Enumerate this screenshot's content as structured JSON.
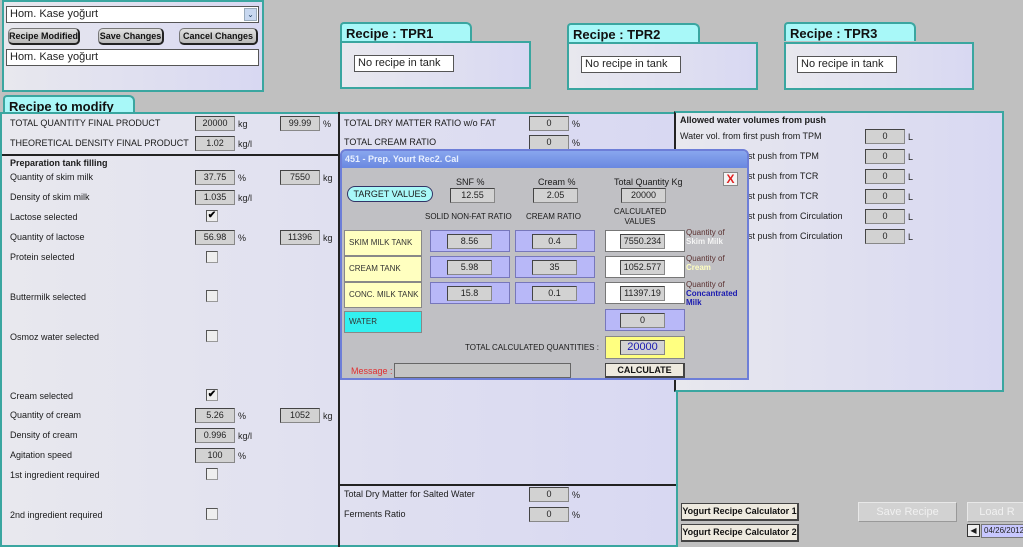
{
  "top_panel": {
    "recipe_select": "Hom. Kase yoğurt",
    "recipe_modified_label": "Recipe Modified",
    "save_changes_label": "Save Changes",
    "cancel_changes_label": "Cancel Changes",
    "recipe_name": "Hom. Kase yoğurt"
  },
  "tanks": [
    {
      "title": "Recipe : TPR1",
      "status": "No recipe in tank"
    },
    {
      "title": "Recipe : TPR2",
      "status": "No recipe in tank"
    },
    {
      "title": "Recipe : TPR3",
      "status": "No recipe in tank"
    }
  ],
  "recipe": {
    "tab_title": "Recipe to modify",
    "total_quantity": {
      "label": "TOTAL QUANTITY FINAL PRODUCT",
      "value": "20000",
      "unit": "kg",
      "value2": "99.99",
      "unit2": "%"
    },
    "theoretical_density": {
      "label": "THEORETICAL DENSITY FINAL PRODUCT",
      "value": "1.02",
      "unit": "kg/l"
    },
    "prep_heading": "Preparation tank filling",
    "skim_qty": {
      "label": "Quantity of skim milk",
      "value": "37.75",
      "unit": "%",
      "value2": "7550",
      "unit2": "kg"
    },
    "skim_density": {
      "label": "Density of skim milk",
      "value": "1.035",
      "unit": "kg/l"
    },
    "lactose_selected": {
      "label": "Lactose selected",
      "checked": "✔"
    },
    "lactose_qty": {
      "label": "Quantity of lactose",
      "value": "56.98",
      "unit": "%",
      "value2": "11396",
      "unit2": "kg"
    },
    "protein_selected": {
      "label": "Protein selected",
      "checked": ""
    },
    "buttermilk_selected": {
      "label": "Buttermilk selected",
      "checked": ""
    },
    "osmoz_selected": {
      "label": "Osmoz water selected",
      "checked": ""
    },
    "cream_selected": {
      "label": "Cream selected",
      "checked": "✔"
    },
    "cream_qty": {
      "label": "Quantity of cream",
      "value": "5.26",
      "unit": "%",
      "value2": "1052",
      "unit2": "kg"
    },
    "cream_density": {
      "label": "Density of cream",
      "value": "0.996",
      "unit": "kg/l"
    },
    "agitation": {
      "label": "Agitation speed",
      "value": "100",
      "unit": "%"
    },
    "ingredient1": {
      "label": "1st ingredient required",
      "checked": ""
    },
    "ingredient2": {
      "label": "2nd ingredient required",
      "checked": ""
    }
  },
  "middle": {
    "dry_matter": {
      "label": "TOTAL DRY MATTER RATIO w/o FAT",
      "value": "0",
      "unit": "%"
    },
    "cream_ratio": {
      "label": "TOTAL CREAM RATIO",
      "value": "0",
      "unit": "%"
    },
    "salted_water": {
      "label": "Total Dry Matter for Salted Water",
      "value": "0",
      "unit": "%"
    },
    "ferments": {
      "label": "Ferments Ratio",
      "value": "0",
      "unit": "%"
    }
  },
  "water": {
    "heading": "Allowed water volumes from push",
    "rows": [
      {
        "label": "Water vol. from first push from TPM",
        "value": "0",
        "unit": "L"
      },
      {
        "label": "st push from TPM",
        "value": "0",
        "unit": "L"
      },
      {
        "label": "st push from TCR",
        "value": "0",
        "unit": "L"
      },
      {
        "label": "st push from TCR",
        "value": "0",
        "unit": "L"
      },
      {
        "label": "st push from Circulation",
        "value": "0",
        "unit": "L"
      },
      {
        "label": "st push from Circulation",
        "value": "0",
        "unit": "L"
      }
    ]
  },
  "dialog": {
    "title": "451 - Prep. Yourt Rec2. Cal",
    "close": "X",
    "target_values_label": "TARGET VALUES",
    "snf_header": "SNF %",
    "cream_header": "Cream %",
    "total_header": "Total Quantity Kg",
    "snf_target": "12.55",
    "cream_target": "2.05",
    "total_target": "20000",
    "col_snf_ratio": "SOLID NON-FAT RATIO",
    "col_cream_ratio": "CREAM RATIO",
    "col_calc": "CALCULATED VALUES",
    "rows": [
      {
        "tank": "SKIM MILK TANK",
        "snf": "8.56",
        "cream": "0.4",
        "calc": "7550.234",
        "qty_label": "Quantity of",
        "qty_name": "Skim Milk"
      },
      {
        "tank": "CREAM TANK",
        "snf": "5.98",
        "cream": "35",
        "calc": "1052.577",
        "qty_label": "Quantity of",
        "qty_name": "Cream"
      },
      {
        "tank": "CONC. MILK TANK",
        "snf": "15.8",
        "cream": "0.1",
        "calc": "11397.19",
        "qty_label": "Quantity of",
        "qty_name": "Concantrated Milk"
      }
    ],
    "water_label": "WATER",
    "water_value": "0",
    "total_calc_label": "TOTAL CALCULATED QUANTITIES :",
    "total_calc_value": "20000",
    "message_label": "Message :",
    "message_value": "",
    "calculate_label": "CALCULATE"
  },
  "bottom": {
    "calc1_label": "Yogurt Recipe Calculator 1",
    "calc2_label": "Yogurt Recipe Calculator 2",
    "save_recipe_label": "Save Recipe",
    "load_recipe_label": "Load R",
    "date": "04/26/2012"
  }
}
